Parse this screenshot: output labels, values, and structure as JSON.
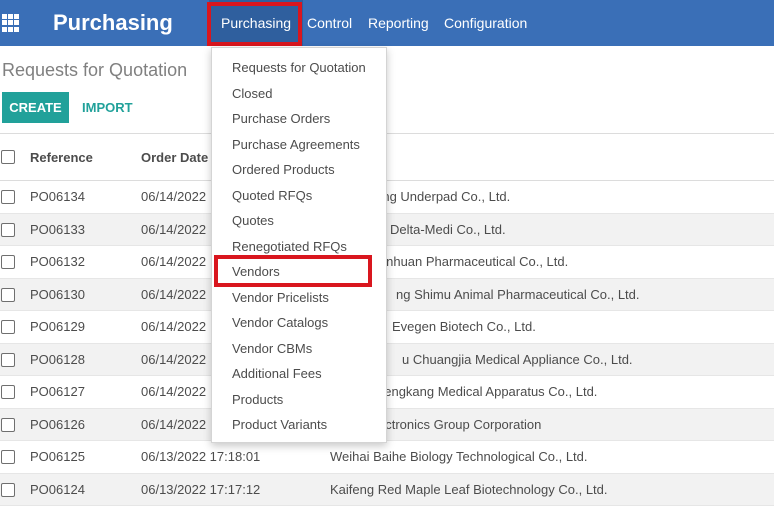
{
  "navbar": {
    "brand": "Purchasing",
    "menu": [
      {
        "label": "Purchasing"
      },
      {
        "label": "Control"
      },
      {
        "label": "Reporting"
      },
      {
        "label": "Configuration"
      }
    ]
  },
  "page": {
    "title": "Requests for Quotation",
    "create_label": "CREATE",
    "import_label": "IMPORT"
  },
  "table": {
    "headers": {
      "reference": "Reference",
      "order_date": "Order Date"
    },
    "rows": [
      {
        "ref": "PO06134",
        "date": "06/14/2022",
        "vendor": "uning Underpad Co., Ltd."
      },
      {
        "ref": "PO06133",
        "date": "06/14/2022",
        "vendor": "Delta-Medi Co., Ltd."
      },
      {
        "ref": "PO06132",
        "date": "06/14/2022",
        "vendor": "ianhuan Pharmaceutical Co., Ltd."
      },
      {
        "ref": "PO06130",
        "date": "06/14/2022",
        "vendor": "ng Shimu Animal Pharmaceutical Co., Ltd."
      },
      {
        "ref": "PO06129",
        "date": "06/14/2022",
        "vendor": "Evegen Biotech Co., Ltd."
      },
      {
        "ref": "PO06128",
        "date": "06/14/2022",
        "vendor": "u Chuangjia Medical Appliance Co., Ltd."
      },
      {
        "ref": "PO06127",
        "date": "06/14/2022",
        "vendor": "hengkang Medical Apparatus Co., Ltd."
      },
      {
        "ref": "PO06126",
        "date": "06/14/2022",
        "vendor": "ectronics Group Corporation"
      },
      {
        "ref": "PO06125",
        "date": "06/13/2022 17:18:01",
        "vendor": "Weihai Baihe Biology Technological Co., Ltd."
      },
      {
        "ref": "PO06124",
        "date": "06/13/2022 17:17:12",
        "vendor": "Kaifeng Red Maple Leaf Biotechnology Co., Ltd."
      }
    ]
  },
  "dropdown": {
    "items": [
      {
        "label": "Requests for Quotation"
      },
      {
        "label": "Closed"
      },
      {
        "label": "Purchase Orders"
      },
      {
        "label": "Purchase Agreements"
      },
      {
        "label": "Ordered Products"
      },
      {
        "label": "Quoted RFQs"
      },
      {
        "label": "Quotes"
      },
      {
        "label": "Renegotiated RFQs"
      },
      {
        "label": "Vendors"
      },
      {
        "label": "Vendor Pricelists"
      },
      {
        "label": "Vendor Catalogs"
      },
      {
        "label": "Vendor CBMs"
      },
      {
        "label": "Additional Fees"
      },
      {
        "label": "Products"
      },
      {
        "label": "Product Variants"
      }
    ]
  },
  "colors": {
    "navbar": "#3a6fb7",
    "accent": "#21a19a",
    "highlight": "#d9161e"
  }
}
